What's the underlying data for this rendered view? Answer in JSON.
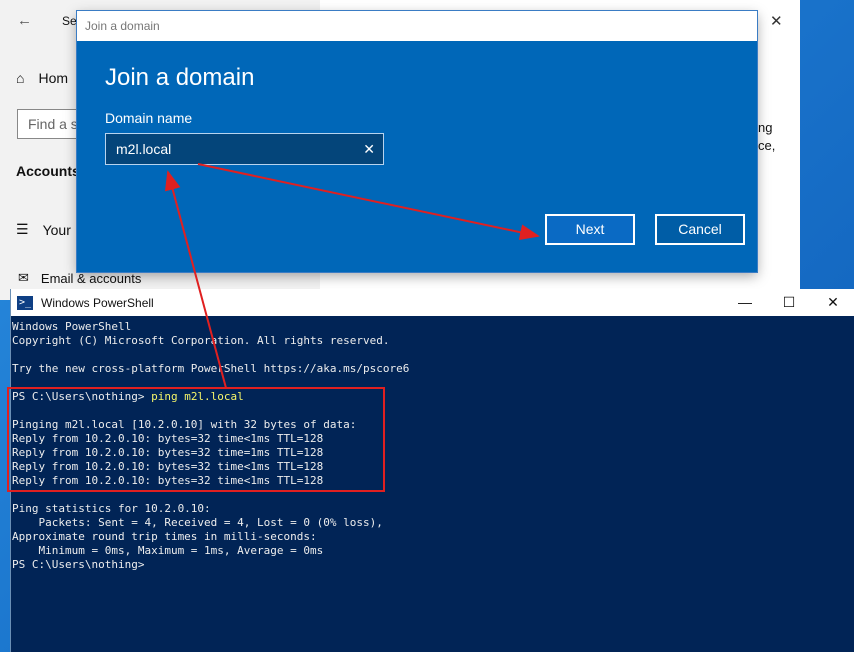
{
  "settings": {
    "title": "Set",
    "home": "Hom",
    "search_placeholder": "Find a se",
    "section": "Accounts",
    "nav_your": "Your",
    "nav_email": "Email & accounts",
    "right_text1": "ng",
    "right_text2": "ce,"
  },
  "dialog": {
    "window_title": "Join a domain",
    "heading": "Join a domain",
    "field_label": "Domain name",
    "field_value": "m2l.local",
    "next_label": "Next",
    "cancel_label": "Cancel"
  },
  "powershell": {
    "window_title": "Windows PowerShell",
    "line1": "Windows PowerShell",
    "line2": "Copyright (C) Microsoft Corporation. All rights reserved.",
    "line3": "Try the new cross-platform PowerShell https://aka.ms/pscore6",
    "prompt1": "PS C:\\Users\\nothing> ",
    "command": "ping m2l.local",
    "ping_header": "Pinging m2l.local [10.2.0.10] with 32 bytes of data:",
    "reply1": "Reply from 10.2.0.10: bytes=32 time<1ms TTL=128",
    "reply2": "Reply from 10.2.0.10: bytes=32 time=1ms TTL=128",
    "reply3": "Reply from 10.2.0.10: bytes=32 time<1ms TTL=128",
    "reply4": "Reply from 10.2.0.10: bytes=32 time<1ms TTL=128",
    "stats_header": "Ping statistics for 10.2.0.10:",
    "stats_packets": "    Packets: Sent = 4, Received = 4, Lost = 0 (0% loss),",
    "rtt_header": "Approximate round trip times in milli-seconds:",
    "rtt_values": "    Minimum = 0ms, Maximum = 1ms, Average = 0ms",
    "prompt2": "PS C:\\Users\\nothing>"
  },
  "colors": {
    "dialog_bg": "#0067b8",
    "console_bg": "#012456",
    "annotation_red": "#e02020"
  }
}
